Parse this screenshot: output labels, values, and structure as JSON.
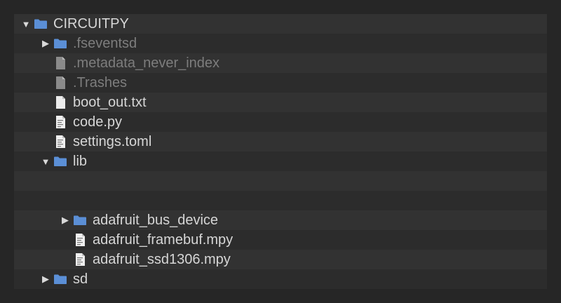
{
  "tree": {
    "rows": [
      {
        "label": "CIRCUITPY",
        "type": "folder",
        "state": "expanded",
        "level": 0,
        "hidden": false
      },
      {
        "label": ".fseventsd",
        "type": "folder",
        "state": "collapsed",
        "level": 1,
        "hidden": true
      },
      {
        "label": ".metadata_never_index",
        "type": "file",
        "state": "none",
        "level": 1,
        "hidden": true
      },
      {
        "label": ".Trashes",
        "type": "file",
        "state": "none",
        "level": 1,
        "hidden": true
      },
      {
        "label": "boot_out.txt",
        "type": "text-file",
        "state": "none",
        "level": 1,
        "hidden": false
      },
      {
        "label": "code.py",
        "type": "code-file",
        "state": "none",
        "level": 1,
        "hidden": false
      },
      {
        "label": "settings.toml",
        "type": "code-file",
        "state": "none",
        "level": 1,
        "hidden": false
      },
      {
        "label": "lib",
        "type": "folder",
        "state": "expanded",
        "level": 1,
        "hidden": false
      },
      {
        "label": "",
        "type": "blank",
        "state": "none",
        "level": 2,
        "hidden": false
      },
      {
        "label": "",
        "type": "blank",
        "state": "none",
        "level": 2,
        "hidden": false
      },
      {
        "label": "adafruit_bus_device",
        "type": "folder",
        "state": "collapsed",
        "level": 2,
        "hidden": false
      },
      {
        "label": "adafruit_framebuf.mpy",
        "type": "code-file",
        "state": "none",
        "level": 2,
        "hidden": false
      },
      {
        "label": "adafruit_ssd1306.mpy",
        "type": "code-file",
        "state": "none",
        "level": 2,
        "hidden": false
      },
      {
        "label": "sd",
        "type": "folder",
        "state": "collapsed",
        "level": 1,
        "hidden": false
      }
    ]
  },
  "colors": {
    "folder": "#5b8fd6",
    "file_white": "#ececec",
    "file_gray": "#8a8a8a"
  }
}
